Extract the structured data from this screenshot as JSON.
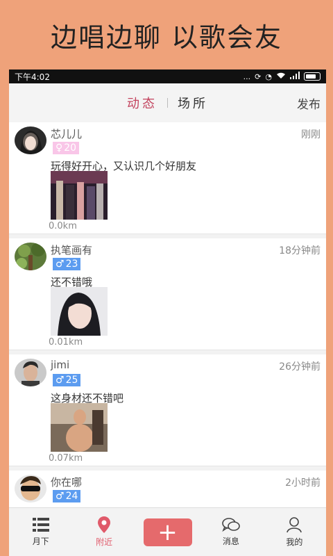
{
  "banner": {
    "text": "边唱边聊  以歌会友"
  },
  "statusbar": {
    "time": "下午4:02",
    "dots": "..."
  },
  "header": {
    "tabs": [
      {
        "label": "动态",
        "active": true
      },
      {
        "label": "场所",
        "active": false
      }
    ],
    "publish_label": "发布"
  },
  "feed": [
    {
      "username": "芯儿儿",
      "time": "刚刚",
      "gender_symbol": "♀",
      "age": "20",
      "gender": "female",
      "text": "玩得好开心，又认识几个好朋友",
      "distance": "0.0km"
    },
    {
      "username": "执笔画有",
      "time": "18分钟前",
      "gender_symbol": "♂",
      "age": "23",
      "gender": "male",
      "text": "还不错哦",
      "distance": "0.01km"
    },
    {
      "username": "jimi",
      "time": "26分钟前",
      "gender_symbol": "♂",
      "age": "25",
      "gender": "male",
      "text": "这身材还不错吧",
      "distance": "0.07km"
    },
    {
      "username": "你在哪",
      "time": "2小时前",
      "gender_symbol": "♂",
      "age": "24",
      "gender": "male",
      "text": "",
      "distance": ""
    }
  ],
  "tabbar": {
    "items": [
      {
        "label": "月下",
        "icon": "list-icon"
      },
      {
        "label": "附近",
        "icon": "location-pin-icon",
        "active": true
      },
      {
        "label": "+",
        "icon": "plus-icon"
      },
      {
        "label": "消息",
        "icon": "chat-bubbles-icon"
      },
      {
        "label": "我的",
        "icon": "user-icon"
      }
    ]
  },
  "colors": {
    "accent": "#C3435E",
    "female": "#F9C6E8",
    "male": "#5C9CF0",
    "plus": "#E56A6C",
    "background": "#EFA27A"
  }
}
